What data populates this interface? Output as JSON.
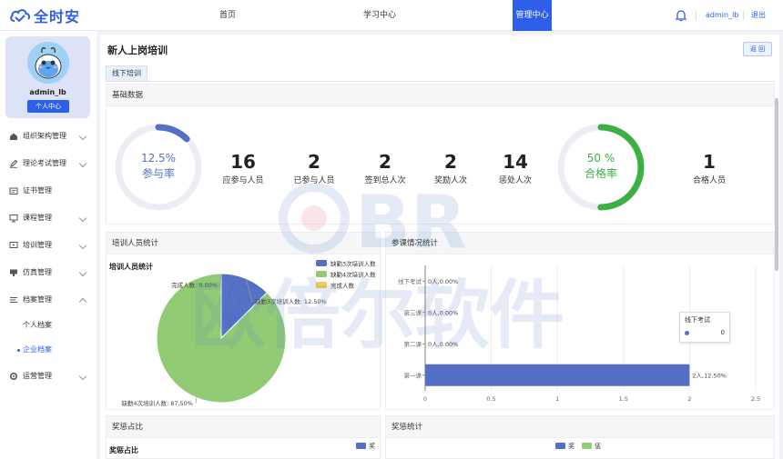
{
  "brand": {
    "name": "全时安",
    "color": "#2d5fe8"
  },
  "nav": {
    "items": [
      {
        "label": "首页"
      },
      {
        "label": "学习中心"
      },
      {
        "label": "管理中心"
      }
    ],
    "active": "管理中心",
    "user": "admin_lb",
    "logout": "退出",
    "bell_icon": "bell-icon"
  },
  "sidebar": {
    "profile": {
      "name": "admin_lb",
      "button": "个人中心"
    },
    "items": [
      {
        "label": "组织架构管理",
        "icon": "org-icon"
      },
      {
        "label": "理论考试管理",
        "icon": "exam-icon"
      },
      {
        "label": "证书管理",
        "icon": "certificate-icon"
      },
      {
        "label": "课程管理",
        "icon": "course-icon"
      },
      {
        "label": "培训管理",
        "icon": "training-icon"
      },
      {
        "label": "仿真管理",
        "icon": "simulation-icon"
      },
      {
        "label": "档案管理",
        "icon": "archive-icon"
      },
      {
        "label": "运营管理",
        "icon": "operations-icon"
      }
    ],
    "sub_items": [
      {
        "label": "个人档案"
      },
      {
        "label": "企业档案"
      }
    ]
  },
  "main": {
    "title": "新人上岗培训",
    "back_label": "返 回",
    "tab": "线下培训",
    "basic": {
      "header": "基础数据",
      "participation_ring": {
        "value": "12.5%",
        "label": "参与率",
        "fraction": 0.125,
        "color": "#5470c6"
      },
      "stats": [
        {
          "value": "16",
          "label": "应参与人员"
        },
        {
          "value": "2",
          "label": "已参与人员"
        },
        {
          "value": "2",
          "label": "签到总人次"
        },
        {
          "value": "2",
          "label": "奖励人次"
        },
        {
          "value": "14",
          "label": "惩处人次"
        }
      ],
      "pass_ring": {
        "value": "50 %",
        "label": "合格率",
        "fraction": 0.5,
        "color": "#3cb043"
      },
      "pass_stat": {
        "value": "1",
        "label": "合格人员"
      }
    },
    "trainee_stats": {
      "header": "培训人员统计",
      "chart_title": "培训人员统计"
    },
    "attendance_stats": {
      "header": "参课情况统计",
      "tooltip": {
        "title": "线下考试",
        "value": "0"
      }
    },
    "reward_ratio": {
      "header": "奖惩占比",
      "chart_title": "奖惩占比",
      "legend": "奖"
    },
    "reward_stats": {
      "header": "奖惩统计",
      "legend": [
        "奖",
        "惩"
      ]
    }
  },
  "chart_data": [
    {
      "type": "pie",
      "title": "培训人员统计",
      "legend_position": "top-right",
      "slices": [
        {
          "name": "缺勤3次培训人数",
          "value": 12.5,
          "color": "#5470c6",
          "label": "缺勤3次培训人数: 12.50%"
        },
        {
          "name": "缺勤4次培训人数",
          "value": 87.5,
          "color": "#91cc75",
          "label": "缺勤4次培训人数: 87.50%"
        },
        {
          "name": "完成人数",
          "value": 0,
          "color": "#fac858",
          "label": "完成人数: 0.00%"
        }
      ]
    },
    {
      "type": "bar",
      "orientation": "horizontal",
      "categories": [
        "第一课",
        "第二课",
        "第三课",
        "线下考试"
      ],
      "values": [
        2,
        0,
        0,
        0
      ],
      "data_labels": [
        "2人,12.50%",
        "0人,0.00%",
        "0人,0.00%",
        "0人,0.00%"
      ],
      "xlim": [
        0,
        2.5
      ],
      "xticks": [
        "0",
        "0.5",
        "1",
        "1.5",
        "2",
        "2.5"
      ],
      "color": "#5470c6",
      "grid": true
    }
  ]
}
